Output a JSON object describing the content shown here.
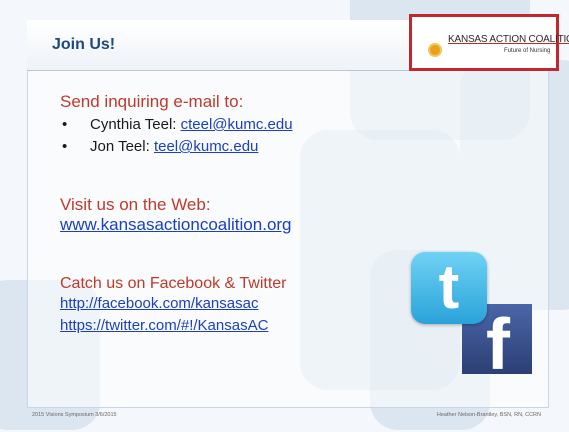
{
  "slide": {
    "title": "Join Us!",
    "logo": {
      "main": "KANSAS ACTION COALITION",
      "sub": "Future of Nursing"
    },
    "email_section": {
      "heading": "Send inquiring e-mail to:",
      "contacts": [
        {
          "name": "Cynthia Teel: ",
          "email": "cteel@kumc.edu"
        },
        {
          "name": "Jon Teel: ",
          "email": "teel@kumc.edu"
        }
      ]
    },
    "web_section": {
      "heading": "Visit us on the Web:",
      "url": "www.kansasactioncoalition.org"
    },
    "social_section": {
      "heading": "Catch us on Facebook & Twitter",
      "facebook_url": "http://facebook.com/kansasac",
      "twitter_url": "https://twitter.com/#!/KansasAC"
    },
    "social_icons": {
      "twitter_glyph": "t",
      "facebook_glyph": "f"
    },
    "footer": {
      "left": "2015 Visions Symposium 3/6/2015",
      "right": "Heather Nelson-Brantley, BSN, RN, CCRN"
    }
  },
  "colors": {
    "title": "#1f497d",
    "heading_red": "#c0392b",
    "link": "#1a3fbf",
    "logo_border": "#c0282d"
  }
}
